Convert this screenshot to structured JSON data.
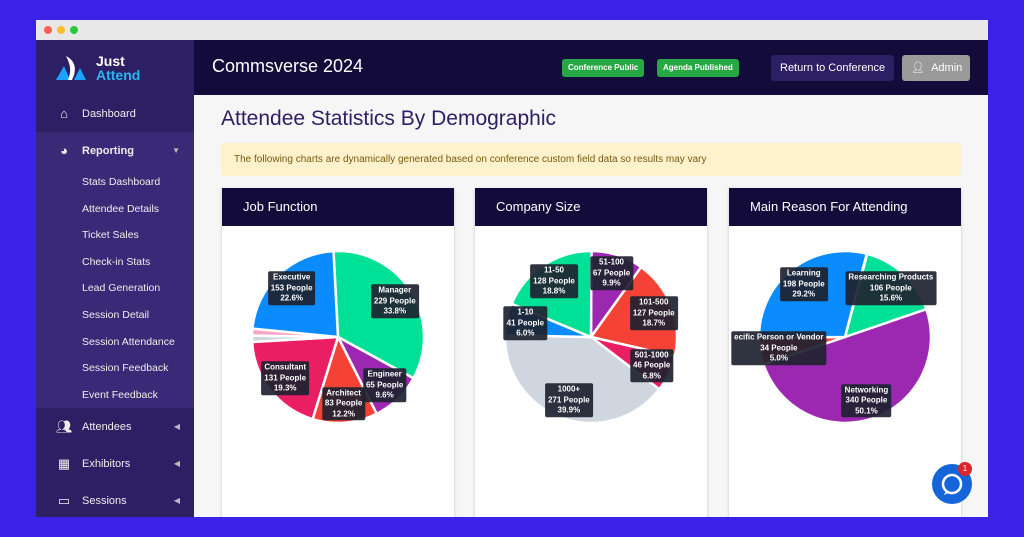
{
  "brand": {
    "line1": "Just",
    "line2": "Attend"
  },
  "sidebar": {
    "items": [
      {
        "label": "Dashboard",
        "icon": "home-icon"
      },
      {
        "label": "Reporting",
        "icon": "pie-chart-icon"
      },
      {
        "label": "Attendees",
        "icon": "users-icon"
      },
      {
        "label": "Exhibitors",
        "icon": "exhibitors-icon"
      },
      {
        "label": "Sessions",
        "icon": "screen-icon"
      }
    ],
    "reporting_sub": [
      "Stats Dashboard",
      "Attendee Details",
      "Ticket Sales",
      "Check-in Stats",
      "Lead Generation",
      "Session Detail",
      "Session Attendance",
      "Session Feedback",
      "Event Feedback"
    ]
  },
  "header": {
    "title": "Commsverse 2024",
    "badges": [
      "Conference Public",
      "Agenda Published"
    ],
    "return_label": "Return to Conference",
    "admin_label": "Admin"
  },
  "main": {
    "title": "Attendee Statistics By Demographic",
    "alert": "The following charts are dynamically generated based on conference custom field data so results may vary"
  },
  "chat": {
    "badge": "1"
  },
  "chart_data": [
    {
      "type": "pie",
      "title": "Job Function",
      "slices": [
        {
          "label": "Manager",
          "people": 229,
          "pct": 33.8,
          "color": "#00e096"
        },
        {
          "label": "Engineer",
          "people": 65,
          "pct": 9.6,
          "color": "#9c27b0"
        },
        {
          "label": "Architect",
          "people": 83,
          "pct": 12.2,
          "color": "#f44336"
        },
        {
          "label": "Consultant",
          "people": 131,
          "pct": 19.3,
          "color": "#e91e63"
        },
        {
          "label": "",
          "people": null,
          "pct": 1.2,
          "color": "#cfd6df"
        },
        {
          "label": "",
          "people": null,
          "pct": 1.3,
          "color": "#f8a5c8"
        },
        {
          "label": "Executive",
          "people": 153,
          "pct": 22.6,
          "color": "#0a8cff"
        }
      ]
    },
    {
      "type": "pie",
      "title": "Company Size",
      "slices": [
        {
          "label": "51-100",
          "people": 67,
          "pct": 9.9,
          "color": "#9c27b0"
        },
        {
          "label": "101-500",
          "people": 127,
          "pct": 18.7,
          "color": "#f44336"
        },
        {
          "label": "501-1000",
          "people": 46,
          "pct": 6.8,
          "color": "#e91e63"
        },
        {
          "label": "1000+",
          "people": 271,
          "pct": 39.9,
          "color": "#cfd6df"
        },
        {
          "label": "1-10",
          "people": 41,
          "pct": 6.0,
          "color": "#0a8cff"
        },
        {
          "label": "11-50",
          "people": 128,
          "pct": 18.8,
          "color": "#00e096"
        }
      ]
    },
    {
      "type": "pie",
      "title": "Main Reason For Attending",
      "slices": [
        {
          "label": "Researching Products",
          "people": 106,
          "pct": 15.6,
          "color": "#00e096"
        },
        {
          "label": "Networking",
          "people": 340,
          "pct": 50.1,
          "color": "#9c27b0"
        },
        {
          "label": "ecific Person or Vendor",
          "people": 34,
          "pct": 5.0,
          "color": "#f44336"
        },
        {
          "label": "Learning",
          "people": 198,
          "pct": 29.2,
          "color": "#0a8cff"
        }
      ]
    }
  ]
}
